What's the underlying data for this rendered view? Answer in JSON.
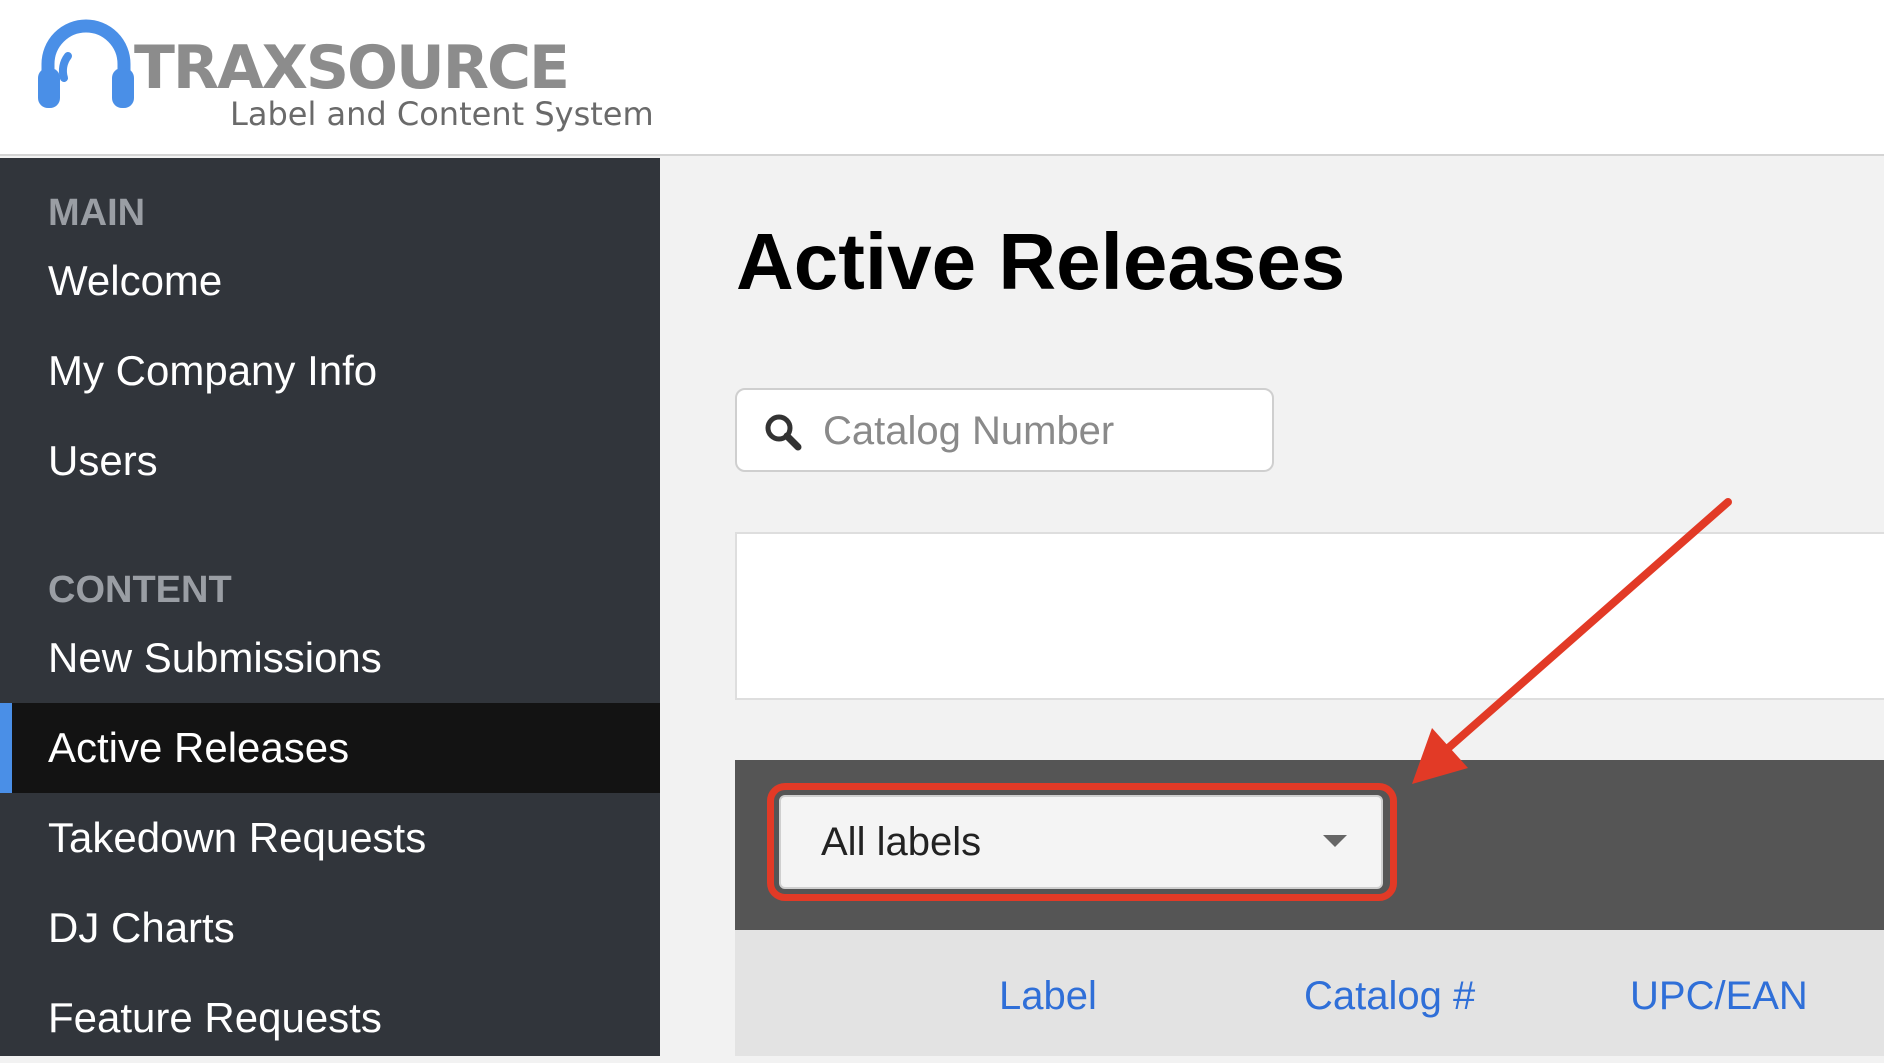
{
  "header": {
    "logo_word": "TRAXSOURCE",
    "logo_tagline": "Label and Content System",
    "logo_color": "#4a8fe7"
  },
  "sidebar": {
    "sections": [
      {
        "title": "MAIN",
        "items": [
          "Welcome",
          "My Company Info",
          "Users"
        ]
      },
      {
        "title": "CONTENT",
        "items": [
          "New Submissions",
          "Active Releases",
          "Takedown Requests",
          "DJ Charts",
          "Feature Requests"
        ]
      }
    ],
    "active_item": "Active Releases",
    "accent_color": "#4a8fe7"
  },
  "main": {
    "title": "Active Releases",
    "search": {
      "placeholder": "Catalog Number",
      "value": ""
    },
    "filter": {
      "selected": "All labels"
    },
    "table": {
      "columns": [
        "Label",
        "Catalog #",
        "UPC/EAN"
      ]
    }
  },
  "annotation": {
    "highlight_color": "#e23a26"
  }
}
